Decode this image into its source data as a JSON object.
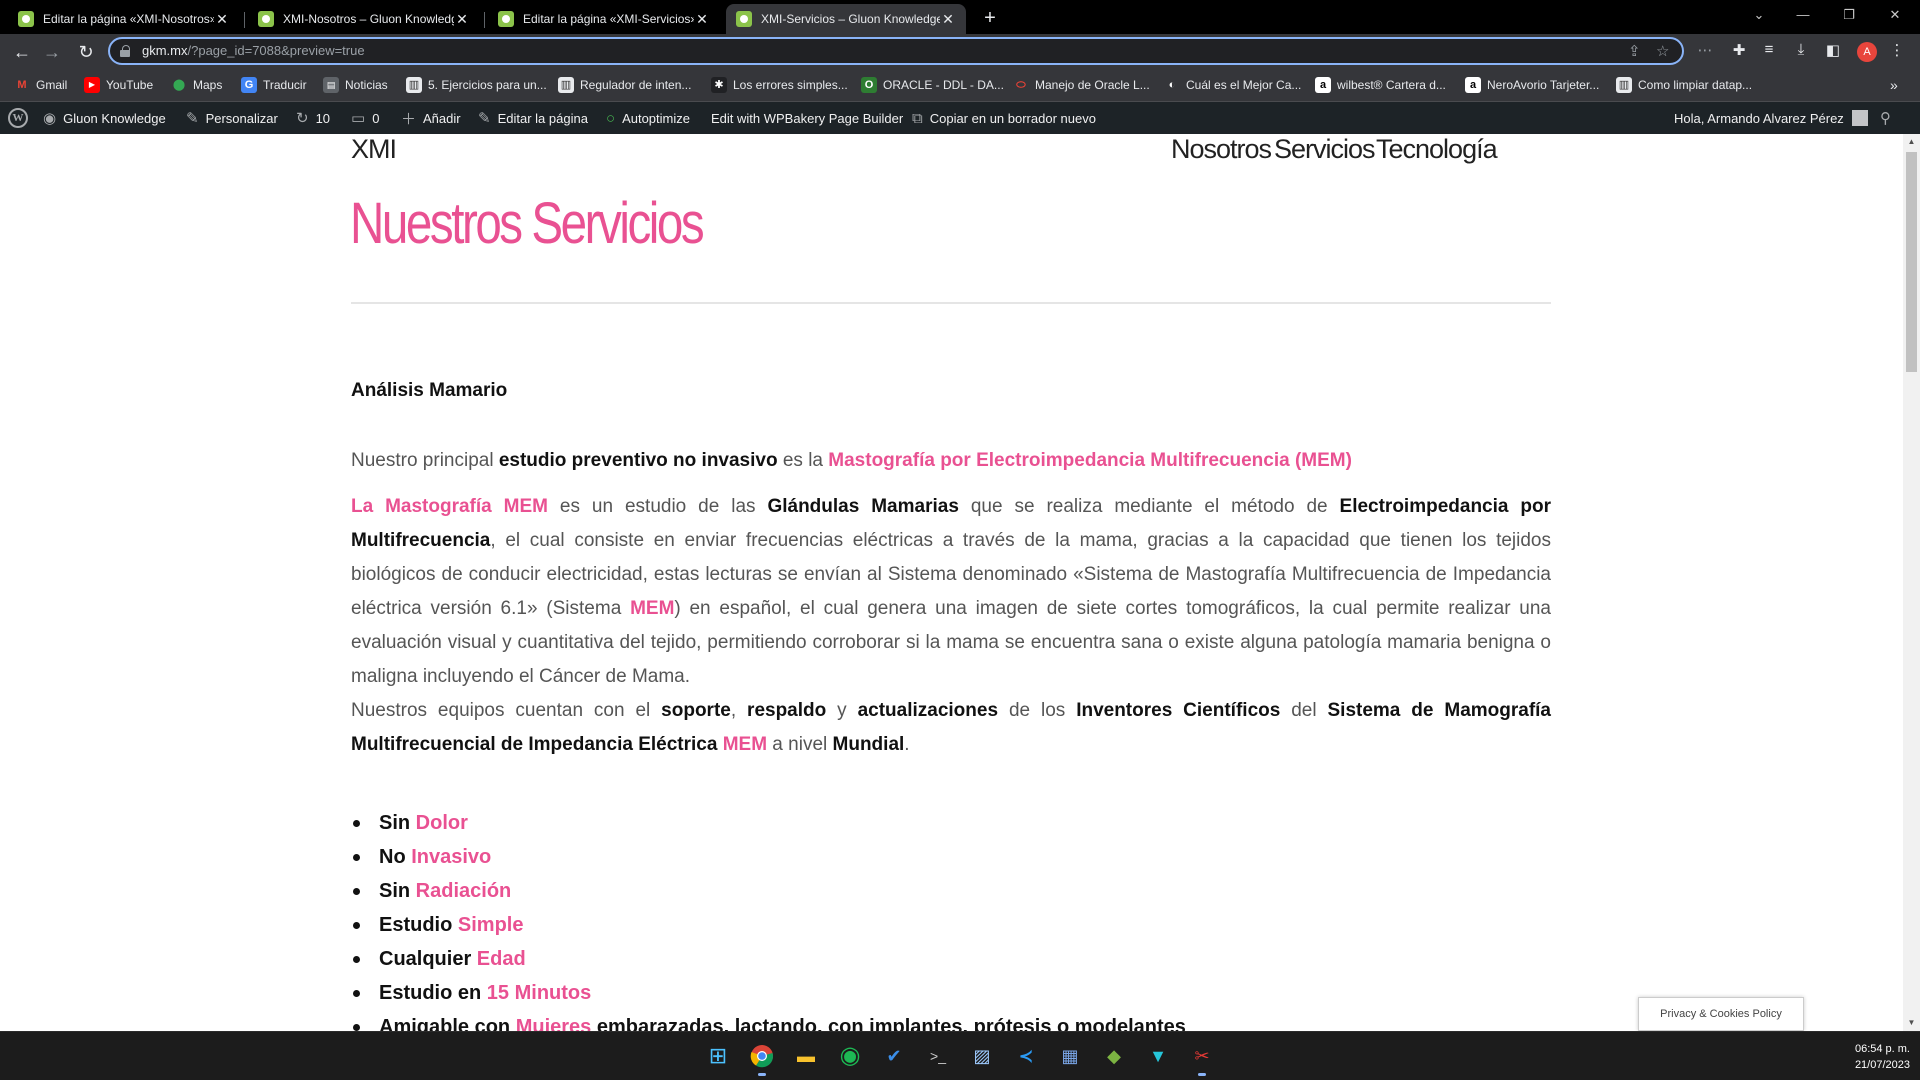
{
  "browser": {
    "tabs": [
      {
        "title": "Editar la página «XMI-Nosotros»"
      },
      {
        "title": "XMI-Nosotros – Gluon Knowledge"
      },
      {
        "title": "Editar la página «XMI-Servicios»"
      },
      {
        "title": "XMI-Servicios – Gluon Knowledge"
      }
    ],
    "active_tab_index": 3,
    "url_domain": "gkm.mx",
    "url_path": "/?page_id=7088&preview=true",
    "profile_initial": "A",
    "accent_color": "#8ab4f8"
  },
  "bookmarks": [
    {
      "label": "Gmail",
      "icon": "gmail-icon"
    },
    {
      "label": "YouTube",
      "icon": "youtube-icon"
    },
    {
      "label": "Maps",
      "icon": "maps-icon"
    },
    {
      "label": "Traducir",
      "icon": "translate-icon"
    },
    {
      "label": "Noticias",
      "icon": "news-icon"
    },
    {
      "label": "5. Ejercicios para un...",
      "icon": "document-icon"
    },
    {
      "label": "Regulador de inten...",
      "icon": "document-icon"
    },
    {
      "label": "Los errores simples...",
      "icon": "document-icon"
    },
    {
      "label": "ORACLE - DDL - DA...",
      "icon": "oracle-icon"
    },
    {
      "label": "Manejo de Oracle L...",
      "icon": "oracle-icon"
    },
    {
      "label": "Cuál es el Mejor Ca...",
      "icon": "globe-icon"
    },
    {
      "label": "wilbest® Cartera d...",
      "icon": "amazon-icon"
    },
    {
      "label": "NeroAvorio Tarjeter...",
      "icon": "amazon-icon"
    },
    {
      "label": "Como limpiar datap...",
      "icon": "document-icon"
    }
  ],
  "wp_admin_bar": {
    "site_name": "Gluon Knowledge",
    "customize": "Personalizar",
    "updates_count": "10",
    "comments_count": "0",
    "add_new": "Añadir",
    "edit_page": "Editar la página",
    "autoptimize": "Autoptimize",
    "wpbakery": "Edit with WPBakery Page Builder",
    "copy_draft": "Copiar en un borrador nuevo",
    "greeting": "Hola, Armando Alvarez Pérez"
  },
  "site": {
    "logo": "XMI",
    "menu": [
      "Nosotros",
      "Servicios",
      "Tecnología"
    ],
    "page_title": "Nuestros Servicios",
    "brand_color": "#e95192"
  },
  "content": {
    "section_title": "Análisis Mamario",
    "p1": {
      "a": "Nuestro principal ",
      "b": "estudio preventivo no invasivo",
      "c": " es la ",
      "d": "Mastografía por Electroimpedancia Multifrecuencia (MEM)"
    },
    "p2": {
      "a": "La Mastografía MEM",
      "b": " es un estudio de las ",
      "c": "Glándulas Mamarias",
      "d": " que se realiza mediante el método de ",
      "e": "Electroimpedancia por Multifrecuencia",
      "f": ", el cual consiste en enviar frecuencias eléctricas a través de la mama, gracias a la capacidad que tienen los tejidos biológicos de conducir electricidad, estas lecturas se envían al Sistema denominado «Sistema de Mastografía Multifrecuencia de Impedancia eléctrica versión 6.1» (Sistema ",
      "g": "MEM",
      "h": ") en español, el cual genera una imagen de siete cortes tomográficos, la cual permite realizar una evaluación visual y cuantitativa del tejido, permitiendo corroborar si la mama se encuentra sana o existe alguna patología mamaria benigna o maligna incluyendo el Cáncer de Mama."
    },
    "p3": {
      "a": "Nuestros equipos cuentan con el ",
      "b": "soporte",
      "c": ", ",
      "d": "respaldo",
      "e": " y ",
      "f": "actualizaciones",
      "g": " de los ",
      "h": "Inventores Científicos",
      "i": " del ",
      "j": "Sistema de Mamografía Multifrecuencial de Impedancia Eléctrica",
      "k": " ",
      "l": "MEM",
      "m": " a nivel ",
      "n": "Mundial",
      "o": "."
    },
    "features": [
      {
        "a": "Sin ",
        "b": "Dolor"
      },
      {
        "a": "No ",
        "b": "Invasivo"
      },
      {
        "a": "Sin ",
        "b": "Radiación"
      },
      {
        "a": "Estudio ",
        "b": "Simple"
      },
      {
        "a": "Cualquier ",
        "b": "Edad"
      },
      {
        "a": "Estudio en ",
        "b": "15 Minutos"
      },
      {
        "a": "Amigable con ",
        "b": "Mujeres",
        "c": " embarazadas, lactando, con implantes, prótesis o modelantes"
      }
    ],
    "privacy_label": "Privacy & Cookies Policy"
  },
  "taskbar": {
    "time": "06:54 p. m.",
    "date": "21/07/2023",
    "apps": [
      "start-icon",
      "chrome-icon",
      "file-explorer-icon",
      "spotify-icon",
      "todo-icon",
      "terminal-icon",
      "photos-icon",
      "vscode-icon",
      "database-icon",
      "game-icon",
      "vpn-icon",
      "snipping-icon"
    ]
  }
}
